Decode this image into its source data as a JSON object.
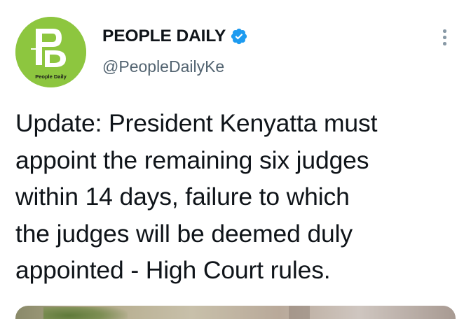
{
  "account": {
    "display_name": "PEOPLE DAILY",
    "handle": "@PeopleDailyKe",
    "verified": true,
    "avatar": {
      "logo_letters": "PD",
      "logo_caption": "People Daily",
      "background_color": "#8dc63f"
    }
  },
  "tweet": {
    "text": "Update: President Kenyatta must\nappoint the remaining six judges\nwithin 14 days, failure to which\nthe judges will be deemed duly\nappointed - High Court rules."
  },
  "icons": {
    "verified": "verified-badge-icon",
    "more": "more-options-icon"
  },
  "colors": {
    "text": "#0f1419",
    "secondary": "#536471",
    "verified_blue": "#1d9bf0",
    "brand_green": "#8dc63f"
  }
}
